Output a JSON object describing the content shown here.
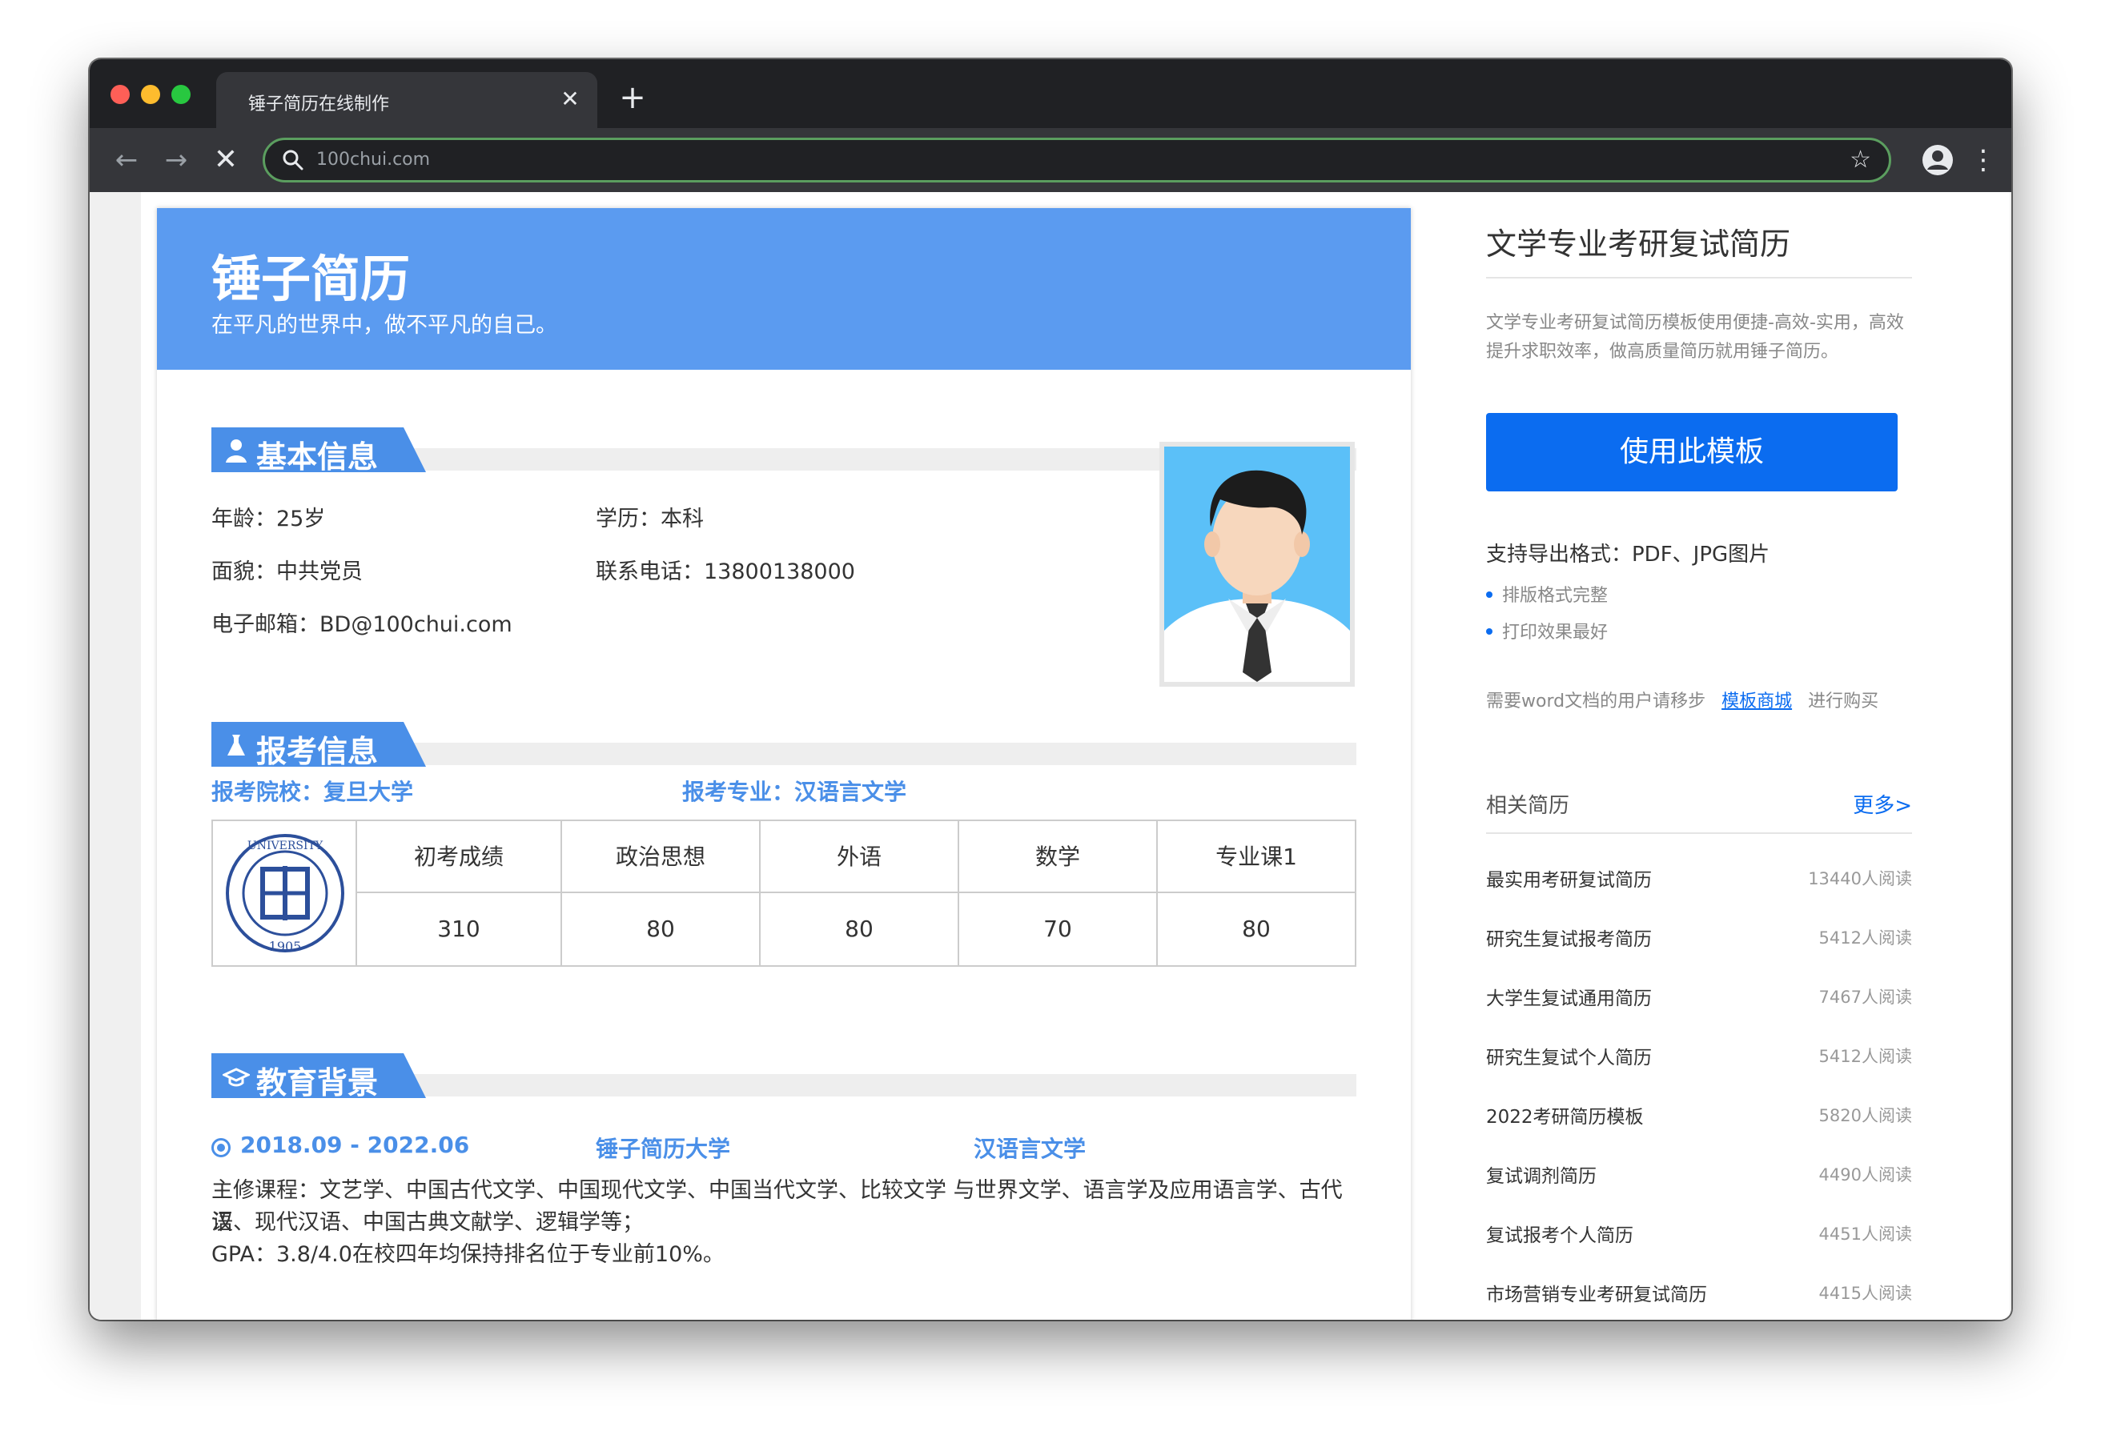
{
  "browser": {
    "tab_title": "锤子简历在线制作",
    "tab_close": "✕",
    "new_tab": "+",
    "url": "100chui.com",
    "back": "←",
    "forward": "→",
    "stop": "✕",
    "star": "☆",
    "menu": "⋮"
  },
  "resume": {
    "title": "锤子简历",
    "subtitle": "在平凡的世界中，做不平凡的自己。",
    "basic": {
      "heading": "基本信息",
      "age": "年龄：25岁",
      "education": "学历：本科",
      "politics": "面貌：中共党员",
      "phone": "联系电话：13800138000",
      "email": "电子邮箱：BD@100chui.com"
    },
    "exam": {
      "heading": "报考信息",
      "school": "报考院校：复旦大学",
      "major": "报考专业：汉语言文学",
      "columns": [
        "初考成绩",
        "政治思想",
        "外语",
        "数学",
        "专业课1"
      ],
      "values": [
        "310",
        "80",
        "80",
        "70",
        "80"
      ]
    },
    "edu": {
      "heading": "教育背景",
      "period": "2018.09 - 2022.06",
      "school": "锤子简历大学",
      "major": "汉语言文学",
      "courses_line1": "主修课程：文艺学、中国古代文学、中国现代文学、中国当代文学、比较文学 与世界文学、语言学及应用语言学、古代汉",
      "courses_line2": "语、现代汉语、中国古典文献学、逻辑学等；",
      "gpa": "GPA：3.8/4.0在校四年均保持排名位于专业前10%。"
    }
  },
  "sidebar": {
    "title": "文学专业考研复试简历",
    "description": "文学专业考研复试简历模板使用便捷-高效-实用，高效提升求职效率，做高质量简历就用锤子简历。",
    "use_button": "使用此模板",
    "export_formats": "支持导出格式：PDF、JPG图片",
    "bullets": [
      "排版格式完整",
      "打印效果最好"
    ],
    "word_prefix": "需要word文档的用户请移步",
    "word_link": "模板商城",
    "word_suffix": "进行购买",
    "related_title": "相关简历",
    "more": "更多>",
    "related": [
      {
        "name": "最实用考研复试简历",
        "count": "13440人阅读"
      },
      {
        "name": "研究生复试报考简历",
        "count": "5412人阅读"
      },
      {
        "name": "大学生复试通用简历",
        "count": "7467人阅读"
      },
      {
        "name": "研究生复试个人简历",
        "count": "5412人阅读"
      },
      {
        "name": "2022考研简历模板",
        "count": "5820人阅读"
      },
      {
        "name": "复试调剂简历",
        "count": "4490人阅读"
      },
      {
        "name": "复试报考个人简历",
        "count": "4451人阅读"
      },
      {
        "name": "市场营销专业考研复试简历",
        "count": "4415人阅读"
      }
    ]
  },
  "colors": {
    "header_blue": "#5b9bf0",
    "section_blue": "#4a8fe8",
    "button_blue": "#0b6cf0"
  },
  "icons": {
    "basic": "user-icon",
    "exam": "flask-icon",
    "edu": "graduation-cap-icon"
  }
}
